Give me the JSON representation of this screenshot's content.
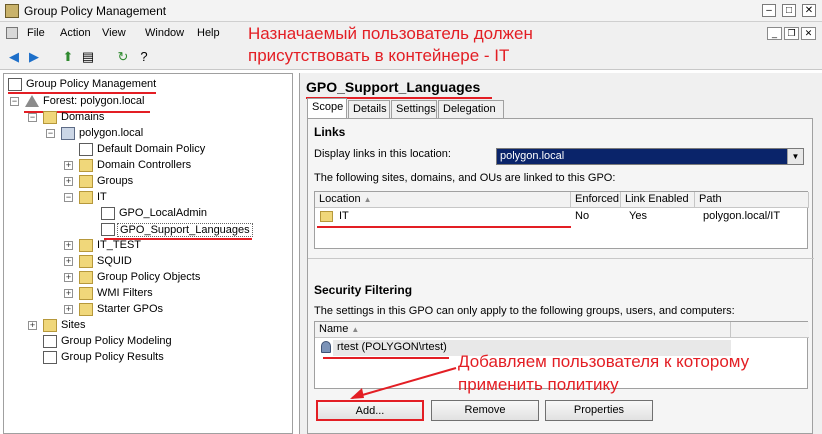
{
  "window": {
    "title": "Group Policy Management"
  },
  "menu": [
    "File",
    "Action",
    "View",
    "Window",
    "Help"
  ],
  "annotations": {
    "top_line1": "Назначаемый пользователь должен",
    "top_line2": "присутствовать в контейнере - IT",
    "bottom_line1": "Добавляем пользователя к которому",
    "bottom_line2": "применить политику"
  },
  "tree": {
    "root": "Group Policy Management",
    "forest": "Forest: polygon.local",
    "domains": "Domains",
    "domain": "polygon.local",
    "default_policy": "Default Domain Policy",
    "domain_controllers": "Domain Controllers",
    "groups": "Groups",
    "it": "IT",
    "gpo_localadmin": "GPO_LocalAdmin",
    "gpo_support": "GPO_Support_Languages",
    "it_test": "IT_TEST",
    "squid": "SQUID",
    "group_policy_objects": "Group Policy Objects",
    "wmi_filters": "WMI Filters",
    "starter_gpos": "Starter GPOs",
    "sites": "Sites",
    "modeling": "Group Policy Modeling",
    "results": "Group Policy Results"
  },
  "details": {
    "header": "GPO_Support_Languages",
    "tabs": [
      "Scope",
      "Details",
      "Settings",
      "Delegation"
    ],
    "links": {
      "title": "Links",
      "display_label": "Display links in this location:",
      "display_value": "polygon.local",
      "linked_text": "The following sites, domains, and OUs are linked to this GPO:",
      "columns": [
        "Location",
        "Enforced",
        "Link Enabled",
        "Path"
      ],
      "rows": [
        {
          "location": "IT",
          "enforced": "No",
          "enabled": "Yes",
          "path": "polygon.local/IT"
        }
      ]
    },
    "security": {
      "title": "Security Filtering",
      "text": "The settings in this GPO can only apply to the following groups, users, and computers:",
      "column": "Name",
      "rows": [
        "rtest (POLYGON\\rtest)"
      ],
      "buttons": {
        "add": "Add...",
        "remove": "Remove",
        "properties": "Properties"
      }
    }
  }
}
